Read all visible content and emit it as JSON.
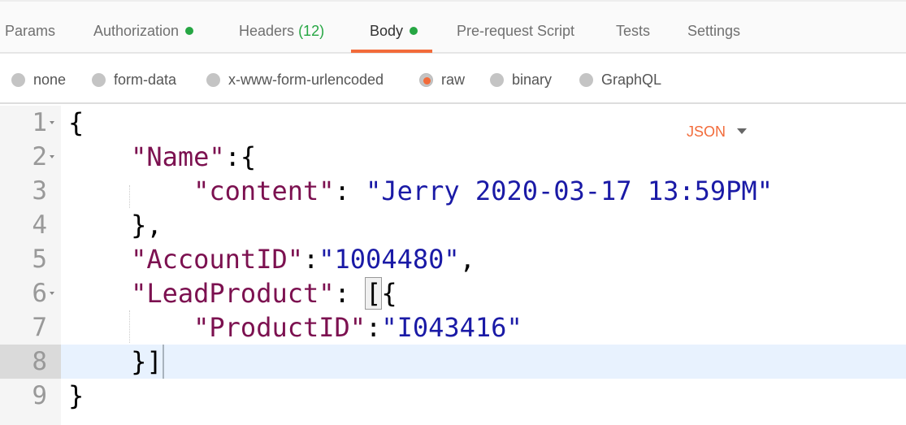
{
  "tabs": [
    {
      "label": "Params"
    },
    {
      "label": "Authorization",
      "dot": true
    },
    {
      "label": "Headers",
      "count": "(12)"
    },
    {
      "label": "Body",
      "dot": true,
      "active": true
    },
    {
      "label": "Pre-request Script"
    },
    {
      "label": "Tests"
    },
    {
      "label": "Settings"
    }
  ],
  "body_types": [
    {
      "label": "none"
    },
    {
      "label": "form-data"
    },
    {
      "label": "x-www-form-urlencoded"
    },
    {
      "label": "raw",
      "selected": true
    },
    {
      "label": "binary"
    },
    {
      "label": "GraphQL"
    }
  ],
  "format": "JSON",
  "colors": {
    "accent": "#f26b3a",
    "green": "#26a643",
    "key": "#7c1150",
    "string": "#1a1aa6"
  },
  "active_line": 8,
  "lines": [
    {
      "n": "1",
      "fold": true,
      "tokens": [
        [
          "p",
          "{"
        ]
      ]
    },
    {
      "n": "2",
      "fold": true,
      "tokens": [
        [
          "p",
          "    "
        ],
        [
          "k",
          "\"Name\""
        ],
        [
          "p",
          ":{"
        ]
      ]
    },
    {
      "n": "3",
      "tokens": [
        [
          "p",
          "        "
        ],
        [
          "k",
          "\"content\""
        ],
        [
          "p",
          ": "
        ],
        [
          "s",
          "\"Jerry 2020-03-17 13:59PM\""
        ]
      ]
    },
    {
      "n": "4",
      "tokens": [
        [
          "p",
          "    },"
        ]
      ]
    },
    {
      "n": "5",
      "tokens": [
        [
          "p",
          "    "
        ],
        [
          "k",
          "\"AccountID\""
        ],
        [
          "p",
          ":"
        ],
        [
          "s",
          "\"1004480\""
        ],
        [
          "p",
          ","
        ]
      ]
    },
    {
      "n": "6",
      "fold": true,
      "tokens": [
        [
          "p",
          "    "
        ],
        [
          "k",
          "\"LeadProduct\""
        ],
        [
          "p",
          ": "
        ],
        [
          "bm",
          "["
        ],
        [
          "p",
          "{"
        ]
      ]
    },
    {
      "n": "7",
      "tokens": [
        [
          "p",
          "        "
        ],
        [
          "k",
          "\"ProductID\""
        ],
        [
          "p",
          ":"
        ],
        [
          "s",
          "\"I043416\""
        ]
      ]
    },
    {
      "n": "8",
      "tokens": [
        [
          "p",
          "    }]"
        ]
      ]
    },
    {
      "n": "9",
      "tokens": [
        [
          "p",
          "}"
        ]
      ]
    }
  ]
}
